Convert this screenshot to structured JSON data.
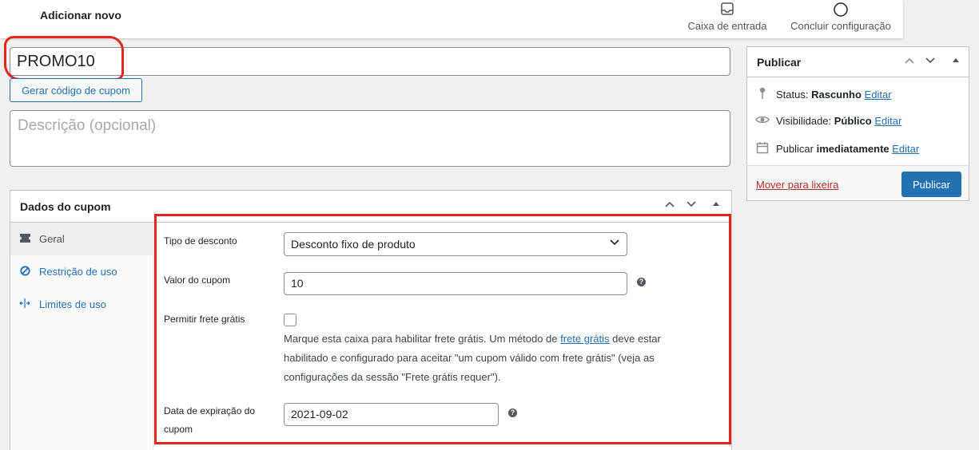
{
  "topbar": {
    "title": "Adicionar novo",
    "inbox_label": "Caixa de entrada",
    "finish_label": "Concluir configuração"
  },
  "coupon": {
    "code_value": "PROMO10",
    "generate_button": "Gerar código de cupom",
    "description_placeholder": "Descrição (opcional)"
  },
  "coupon_data": {
    "title": "Dados do cupom",
    "tabs": [
      {
        "label": "Geral",
        "icon": "ticket-icon"
      },
      {
        "label": "Restrição de uso",
        "icon": "block-icon"
      },
      {
        "label": "Limites de uso",
        "icon": "arrows-icon"
      }
    ],
    "fields": {
      "discount_type_label": "Tipo de desconto",
      "discount_type_value": "Desconto fixo de produto",
      "amount_label": "Valor do cupom",
      "amount_value": "10",
      "free_shipping_label": "Permitir frete grátis",
      "free_shipping_note_before": "Marque esta caixa para habilitar frete grátis. Um método de ",
      "free_shipping_link": "frete grátis",
      "free_shipping_note_after": " deve estar habilitado e configurado para aceitar \"um cupom válido com frete grátis\" (veja as configurações da sessão \"Frete grátis requer\").",
      "expiry_label": "Data de expiração do cupom",
      "expiry_value": "2021-09-02"
    }
  },
  "publish": {
    "title": "Publicar",
    "status_label": "Status:",
    "status_value": "Rascunho",
    "visibility_label": "Visibilidade:",
    "visibility_value": "Público",
    "schedule_label": "Publicar",
    "schedule_value": "imediatamente",
    "edit_link": "Editar",
    "trash_link": "Mover para lixeira",
    "publish_button": "Publicar"
  },
  "colors": {
    "accent": "#2271b1",
    "annotation_red": "#e5261c",
    "trash_red": "#b32d2e"
  }
}
